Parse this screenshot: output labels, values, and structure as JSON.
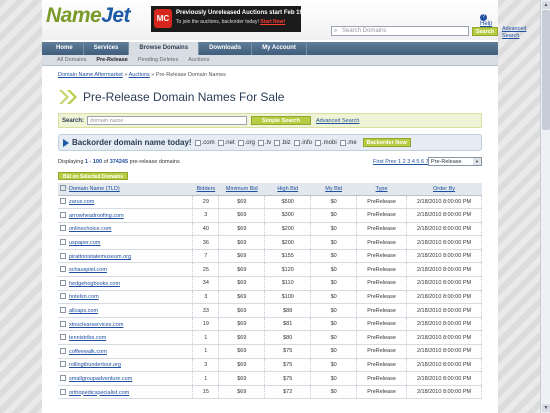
{
  "header": {
    "logo_part1": "Name",
    "logo_part2": "Jet",
    "promo_badge": "MC",
    "promo_line1": "Previously Unreleased Auctions start Feb 19th",
    "promo_line2": "To join the auctions, backorder today!",
    "promo_cta": "Start Now!",
    "search_placeholder": "Search Domains",
    "search_button": "Search",
    "advanced_search": "Advanced Search",
    "help": "Help"
  },
  "nav": {
    "items": [
      "Home",
      "Services",
      "Browse Domains",
      "Downloads",
      "My Account"
    ],
    "active": "Browse Domains"
  },
  "subnav": {
    "items": [
      "All Domains",
      "Pre-Release",
      "Pending Deletes",
      "Auctions"
    ],
    "active": "Pre-Release"
  },
  "breadcrumb": {
    "home": "Domain Name Aftermarket",
    "sep": "»",
    "auctions": "Auctions",
    "current": "Pre-Release Domain Names"
  },
  "page_title": "Pre-Release Domain Names For Sale",
  "search": {
    "label": "Search:",
    "placeholder": "domain name",
    "button": "Simple Search",
    "advanced": "Advanced Search"
  },
  "backorder": {
    "label": "Backorder domain name today!",
    "tlds": [
      ".com",
      ".net",
      ".org",
      ".tv",
      ".biz",
      ".info",
      ".mobi",
      ".me"
    ],
    "button": "Backorder Now"
  },
  "display": {
    "prefix": "Displaying",
    "range": "1 - 100",
    "of": "of",
    "total": "374245",
    "suffix": "pre-release domains",
    "pager": "First Prev 1 2 3 4 5 6 7 8 9 10 ... Next Last",
    "filter": "Pre-Release"
  },
  "bid_button": "Bid on Selected Domains",
  "table": {
    "headers": [
      "Domain Name (TLD)",
      "Bidders",
      "Minimum Bid",
      "High Bid",
      "My Bid",
      "Type",
      "Order By"
    ],
    "rows": [
      [
        "zarus.com",
        "29",
        "$69",
        "$500",
        "$0",
        "PreRelease",
        "2/18/2010 8:00:00 PM"
      ],
      [
        "arrowheadroofing.com",
        "3",
        "$69",
        "$300",
        "$0",
        "PreRelease",
        "2/18/2010 8:00:00 PM"
      ],
      [
        "onlinechoice.com",
        "40",
        "$69",
        "$200",
        "$0",
        "PreRelease",
        "2/18/2010 8:00:00 PM"
      ],
      [
        "uspaper.com",
        "36",
        "$69",
        "$200",
        "$0",
        "PreRelease",
        "2/18/2010 8:00:00 PM"
      ],
      [
        "pirattonistatemuseum.org",
        "7",
        "$69",
        "$155",
        "$0",
        "PreRelease",
        "2/18/2010 8:00:00 PM"
      ],
      [
        "schauspiel.com",
        "25",
        "$69",
        "$120",
        "$0",
        "PreRelease",
        "2/18/2010 8:00:00 PM"
      ],
      [
        "hedgehogbooks.com",
        "34",
        "$69",
        "$110",
        "$0",
        "PreRelease",
        "2/18/2010 8:00:00 PM"
      ],
      [
        "hotelsn.com",
        "3",
        "$69",
        "$100",
        "$0",
        "PreRelease",
        "2/18/2010 8:00:00 PM"
      ],
      [
        "allcaps.com",
        "33",
        "$69",
        "$88",
        "$0",
        "PreRelease",
        "2/18/2010 8:00:00 PM"
      ],
      [
        "xtnuclearservices.com",
        "19",
        "$69",
        "$81",
        "$0",
        "PreRelease",
        "2/18/2010 8:00:00 PM"
      ],
      [
        "tennistribe.com",
        "1",
        "$69",
        "$80",
        "$0",
        "PreRelease",
        "2/18/2010 8:00:00 PM"
      ],
      [
        "coffeewalk.com",
        "1",
        "$69",
        "$75",
        "$0",
        "PreRelease",
        "2/18/2010 8:00:00 PM"
      ],
      [
        "rollingthundertour.org",
        "3",
        "$69",
        "$75",
        "$0",
        "PreRelease",
        "2/18/2010 8:00:00 PM"
      ],
      [
        "smallgroupadventure.com",
        "1",
        "$69",
        "$75",
        "$0",
        "PreRelease",
        "2/18/2010 8:00:00 PM"
      ],
      [
        "orthopedicspecialist.com",
        "15",
        "$69",
        "$72",
        "$0",
        "PreRelease",
        "2/18/2010 8:00:00 PM"
      ]
    ]
  }
}
